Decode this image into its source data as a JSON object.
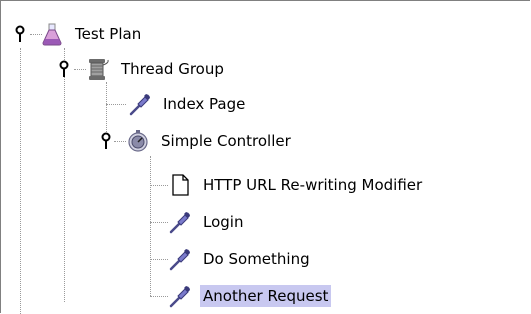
{
  "tree": {
    "test_plan": {
      "label": "Test Plan",
      "icon": "flask-icon"
    },
    "thread_group": {
      "label": "Thread Group",
      "icon": "spool-icon"
    },
    "index_page": {
      "label": "Index Page",
      "icon": "pipette-icon"
    },
    "simple_controller": {
      "label": "Simple Controller",
      "icon": "controller-icon"
    },
    "url_rewriting": {
      "label": "HTTP URL Re-writing Modifier",
      "icon": "document-icon"
    },
    "login": {
      "label": "Login",
      "icon": "pipette-icon"
    },
    "do_something": {
      "label": "Do Something",
      "icon": "pipette-icon"
    },
    "another_request": {
      "label": "Another Request",
      "icon": "pipette-icon",
      "selected": true
    }
  },
  "colors": {
    "selection": "#c8c8f0",
    "connector": "#9a9a9a"
  }
}
